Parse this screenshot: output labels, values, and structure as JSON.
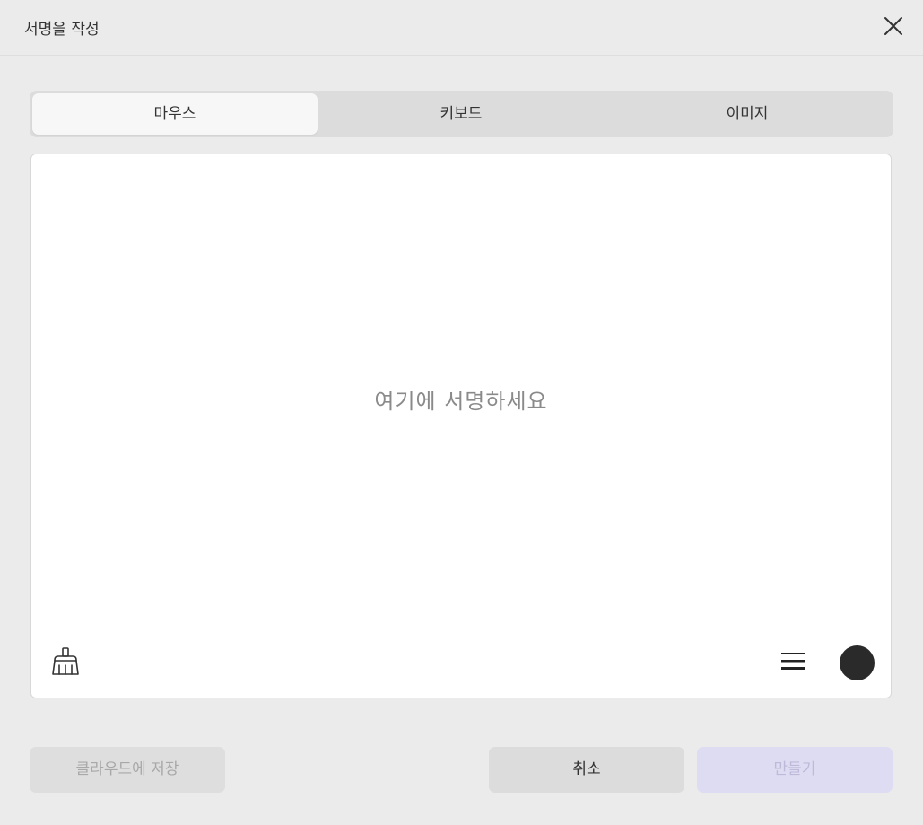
{
  "dialog": {
    "title": "서명을 작성",
    "close_icon": "close-icon"
  },
  "tabs": [
    {
      "label": "마우스",
      "active": true
    },
    {
      "label": "키보드",
      "active": false
    },
    {
      "label": "이미지",
      "active": false
    }
  ],
  "canvas": {
    "placeholder": "여기에 서명하세요",
    "eraser_icon": "broom-icon",
    "stroke_icon": "stroke-width-icon",
    "pen_color": "#2a2a2a"
  },
  "footer": {
    "cloud_label": "클라우드에 저장",
    "cancel_label": "취소",
    "create_label": "만들기"
  },
  "colors": {
    "background": "#ebebeb",
    "canvas": "#ffffff",
    "create_button_bg": "#dedcf2"
  }
}
